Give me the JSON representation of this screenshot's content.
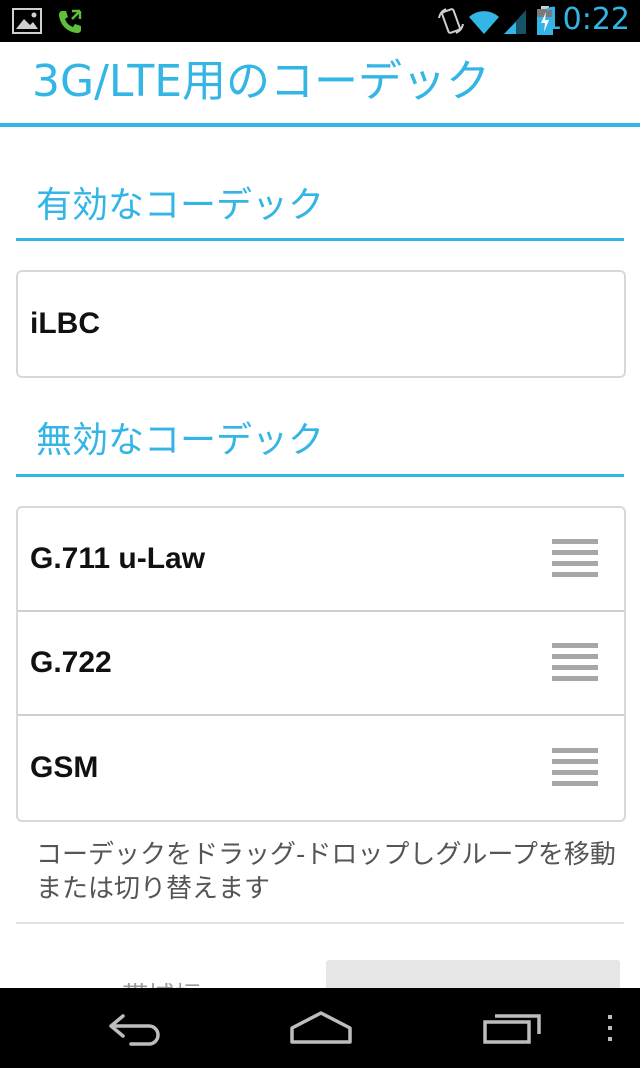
{
  "status_bar": {
    "time": "10:22",
    "icons": [
      "gallery-icon",
      "phone-icon",
      "rotate-icon",
      "wifi-icon",
      "signal-icon",
      "battery-icon"
    ],
    "accent_color": "#33b5e5"
  },
  "header": {
    "title": "3G/LTE用のコーデック"
  },
  "enabled_section": {
    "header": "有効なコーデック",
    "codecs": [
      {
        "label": "iLBC"
      }
    ]
  },
  "disabled_section": {
    "header": "無効なコーデック",
    "codecs": [
      {
        "label": "G.711 u-Law"
      },
      {
        "label": "G.722"
      },
      {
        "label": "GSM"
      }
    ]
  },
  "hint": "コーデックをドラッグ-ドロップしグループを移動または切り替えます",
  "next_setting": {
    "label": "ーーー 帯域幅"
  },
  "nav_bar": {
    "icons": [
      "back-icon",
      "home-icon",
      "recents-icon",
      "menu-icon"
    ]
  },
  "colors": {
    "accent": "#33b5e5",
    "status_bar_bg": "#000000",
    "nav_bar_bg": "#000000",
    "divider": "#cfcfcf"
  }
}
